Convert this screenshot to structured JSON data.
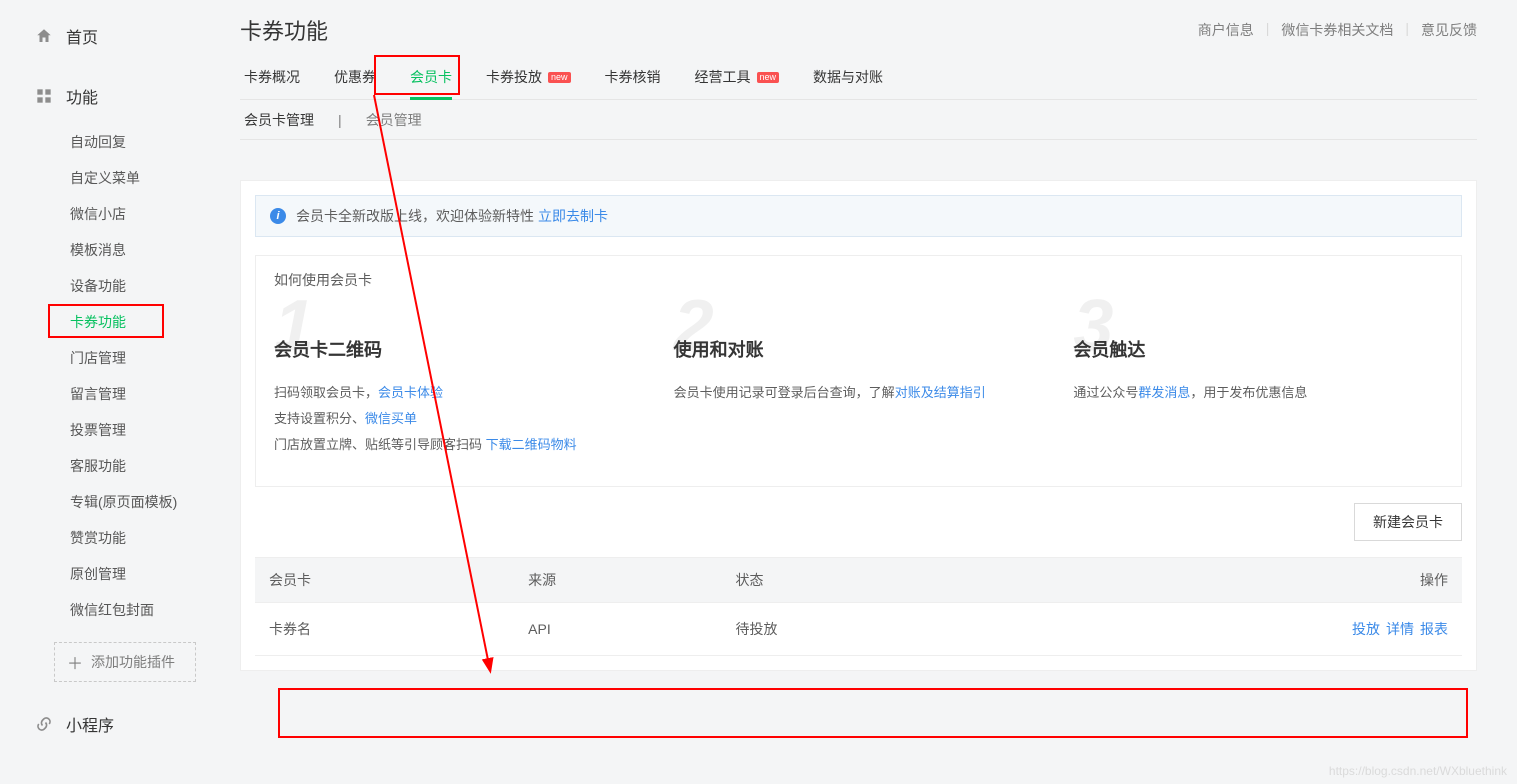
{
  "sidebar": {
    "home": "首页",
    "features_heading": "功能",
    "miniprogram_heading": "小程序",
    "items": [
      "自动回复",
      "自定义菜单",
      "微信小店",
      "模板消息",
      "设备功能",
      "卡券功能",
      "门店管理",
      "留言管理",
      "投票管理",
      "客服功能",
      "专辑(原页面模板)",
      "赞赏功能",
      "原创管理",
      "微信红包封面"
    ],
    "active_index": 5,
    "plugin_button": "添加功能插件"
  },
  "header": {
    "title": "卡券功能",
    "links": [
      "商户信息",
      "微信卡券相关文档",
      "意见反馈"
    ]
  },
  "tabs": {
    "items": [
      {
        "label": "卡券概况",
        "new": false
      },
      {
        "label": "优惠券",
        "new": false
      },
      {
        "label": "会员卡",
        "new": false
      },
      {
        "label": "卡券投放",
        "new": true
      },
      {
        "label": "卡券核销",
        "new": false
      },
      {
        "label": "经营工具",
        "new": true
      },
      {
        "label": "数据与对账",
        "new": false
      }
    ],
    "active_index": 2
  },
  "subtabs": {
    "items": [
      "会员卡管理",
      "会员管理"
    ],
    "active_index": 0
  },
  "notice": {
    "text": "会员卡全新改版上线，欢迎体验新特性",
    "link": "立即去制卡"
  },
  "howto": {
    "title": "如何使用会员卡",
    "steps": [
      {
        "num": "1",
        "title": "会员卡二维码",
        "lines": [
          {
            "pre": "扫码领取会员卡，",
            "link": "会员卡体验",
            "post": ""
          },
          {
            "pre": "支持设置积分、",
            "link": "微信买单",
            "post": ""
          },
          {
            "pre": "门店放置立牌、贴纸等引导顾客扫码 ",
            "link": "下载二维码物料",
            "post": ""
          }
        ]
      },
      {
        "num": "2",
        "title": "使用和对账",
        "lines": [
          {
            "pre": "会员卡使用记录可登录后台查询，了解",
            "link": "对账及结算指引",
            "post": ""
          }
        ]
      },
      {
        "num": "3",
        "title": "会员触达",
        "lines": [
          {
            "pre": "通过公众号",
            "link": "群发消息",
            "post": "，用于发布优惠信息"
          }
        ]
      }
    ]
  },
  "toolbar": {
    "new_card": "新建会员卡"
  },
  "table": {
    "headers": [
      "会员卡",
      "来源",
      "状态",
      "操作"
    ],
    "rows": [
      {
        "name": "卡券名",
        "source": "API",
        "status": "待投放",
        "actions": [
          "投放",
          "详情",
          "报表"
        ]
      }
    ]
  },
  "watermark": "https://blog.csdn.net/WXbluethink"
}
